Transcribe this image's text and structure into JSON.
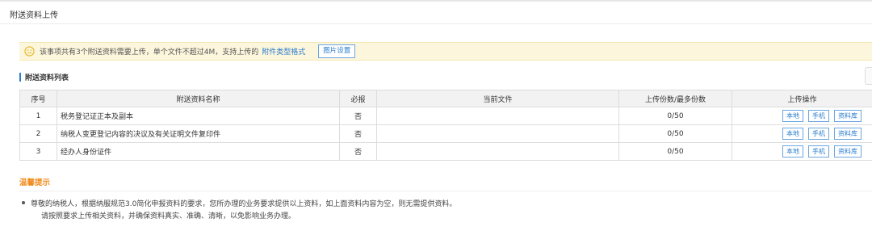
{
  "page": {
    "title": "附送资料上传"
  },
  "notice": {
    "text": "该事项共有3个附送资料需要上传，单个文件不超过4M，支持上传的",
    "link": "附件类型格式",
    "button": "图片设置"
  },
  "list": {
    "title": "附送资料列表",
    "columns": [
      "序号",
      "附送资料名称",
      "必报",
      "当前文件",
      "上传份数/最多份数",
      "上传操作"
    ],
    "rows": [
      {
        "no": "1",
        "name": "税务登记证正本及副本",
        "required": "否",
        "file": "",
        "count": "0/50"
      },
      {
        "no": "2",
        "name": "纳税人变更登记内容的决议及有关证明文件复印件",
        "required": "否",
        "file": "",
        "count": "0/50"
      },
      {
        "no": "3",
        "name": "经办人身份证件",
        "required": "否",
        "file": "",
        "count": "0/50"
      }
    ],
    "ops": {
      "local": "本地",
      "phone": "手机",
      "library": "资料库"
    }
  },
  "tips": {
    "title": "温馨提示",
    "line1": "尊敬的纳税人，根据纳服规范3.0简化申报资料的要求，您所办理的业务要求提供以上资料，如上面资料内容为空，则无需提供资料。",
    "line2": "请按照要求上传相关资料，并确保资料真实、准确、清晰，以免影响业务办理。"
  },
  "colors": {
    "accent": "#2a7ccf",
    "warning": "#f08a1c",
    "notice_bg": "#fcf6dc"
  },
  "icons": {
    "notice": "smile-icon"
  }
}
